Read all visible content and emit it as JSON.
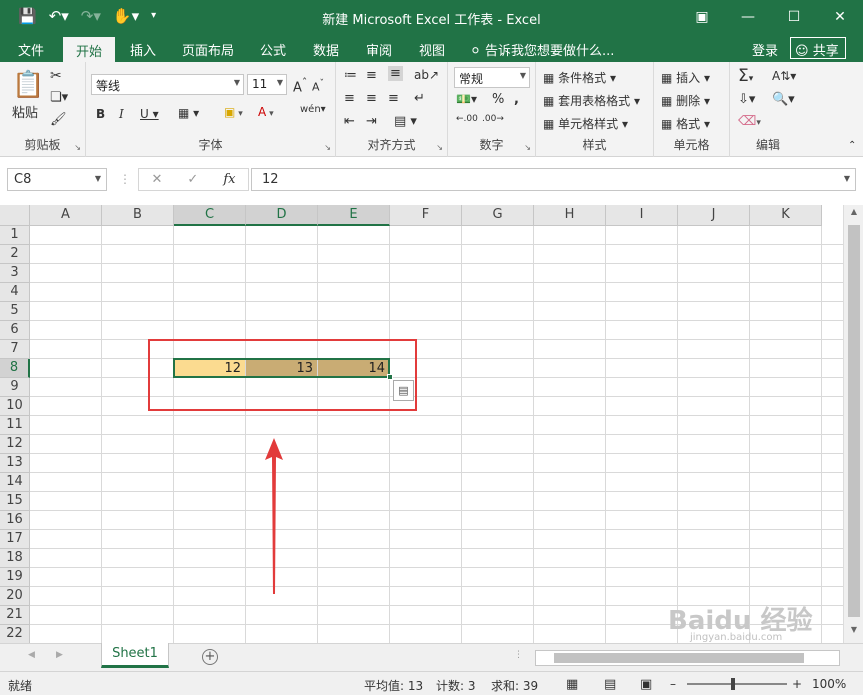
{
  "titlebar": {
    "title": "新建 Microsoft Excel 工作表 - Excel"
  },
  "tabs": [
    "文件",
    "开始",
    "插入",
    "页面布局",
    "公式",
    "数据",
    "审阅",
    "视图"
  ],
  "tell_me": "告诉我您想要做什么...",
  "login": "登录",
  "share": "共享",
  "ribbon": {
    "clipboard": {
      "paste": "粘贴",
      "label": "剪贴板"
    },
    "font": {
      "name": "等线",
      "size": "11",
      "label": "字体"
    },
    "alignment": {
      "label": "对齐方式"
    },
    "number": {
      "format": "常规",
      "label": "数字"
    },
    "styles": {
      "conditional": "条件格式",
      "table": "套用表格格式",
      "cell": "单元格样式",
      "label": "样式"
    },
    "cells": {
      "insert": "插入",
      "delete": "删除",
      "format": "格式",
      "label": "单元格"
    },
    "editing": {
      "label": "编辑"
    }
  },
  "formula_bar": {
    "name_box": "C8",
    "formula": "12"
  },
  "columns": [
    "A",
    "B",
    "C",
    "D",
    "E",
    "F",
    "G",
    "H",
    "I",
    "J",
    "K"
  ],
  "rows": [
    "1",
    "2",
    "3",
    "4",
    "5",
    "6",
    "7",
    "8",
    "9",
    "10",
    "11",
    "12",
    "13",
    "14",
    "15",
    "16",
    "17",
    "18",
    "19",
    "20",
    "21",
    "22"
  ],
  "cells": {
    "C8": "12",
    "D8": "13",
    "E8": "14"
  },
  "colors": {
    "excel_green": "#217346",
    "cell_c8": "#fbdb90",
    "cell_d8_e8": "#c9ac74",
    "annotation_red": "#e23b3b"
  },
  "sheet_tabs": [
    "Sheet1"
  ],
  "status": {
    "ready": "就绪",
    "average": "平均值: 13",
    "count": "计数: 3",
    "sum": "求和: 39",
    "zoom": "100%"
  },
  "watermark": {
    "main": "Baidu 经验",
    "sub": "jingyan.baidu.com"
  }
}
